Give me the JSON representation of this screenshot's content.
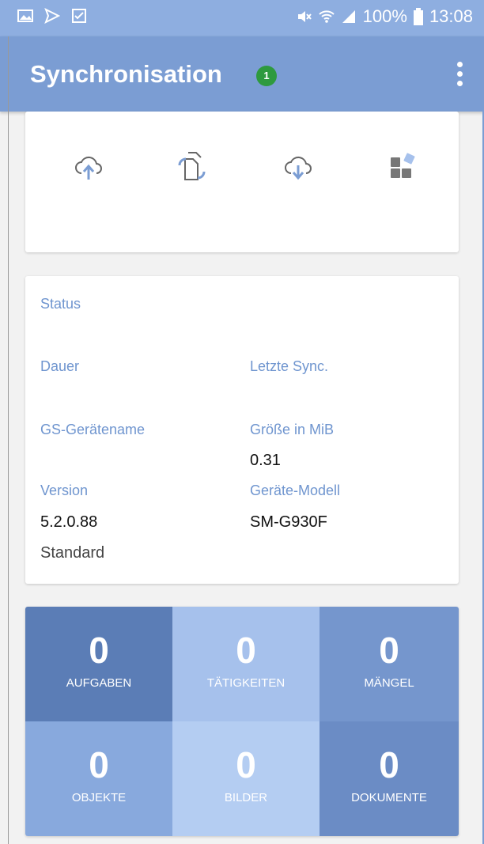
{
  "status_bar": {
    "battery": "100%",
    "time": "13:08"
  },
  "app_bar": {
    "title": "Synchronisation",
    "badge_count": "1"
  },
  "actions": [
    {
      "icon": "cloud-upload-icon"
    },
    {
      "icon": "sync-documents-icon"
    },
    {
      "icon": "cloud-download-icon"
    },
    {
      "icon": "widgets-icon"
    }
  ],
  "status": {
    "heading": "Status",
    "dauer_label": "Dauer",
    "letzte_sync_label": "Letzte Sync.",
    "geraetename_label": "GS-Gerätename",
    "groesse_label": "Größe in MiB",
    "groesse_value": "0.31",
    "version_label": "Version",
    "version_value": "5.2.0.88",
    "modell_label": "Geräte-Modell",
    "modell_value": "SM-G930F",
    "profile_value": "Standard"
  },
  "stats": [
    {
      "count": "0",
      "label": "AUFGABEN",
      "color": "#5b7db6"
    },
    {
      "count": "0",
      "label": "TÄTIGKEITEN",
      "color": "#a6c1ec"
    },
    {
      "count": "0",
      "label": "MÄNGEL",
      "color": "#7596cd"
    },
    {
      "count": "0",
      "label": "OBJEKTE",
      "color": "#88a9dd"
    },
    {
      "count": "0",
      "label": "BILDER",
      "color": "#b4cdf2"
    },
    {
      "count": "0",
      "label": "DOKUMENTE",
      "color": "#6b8cc5"
    }
  ]
}
